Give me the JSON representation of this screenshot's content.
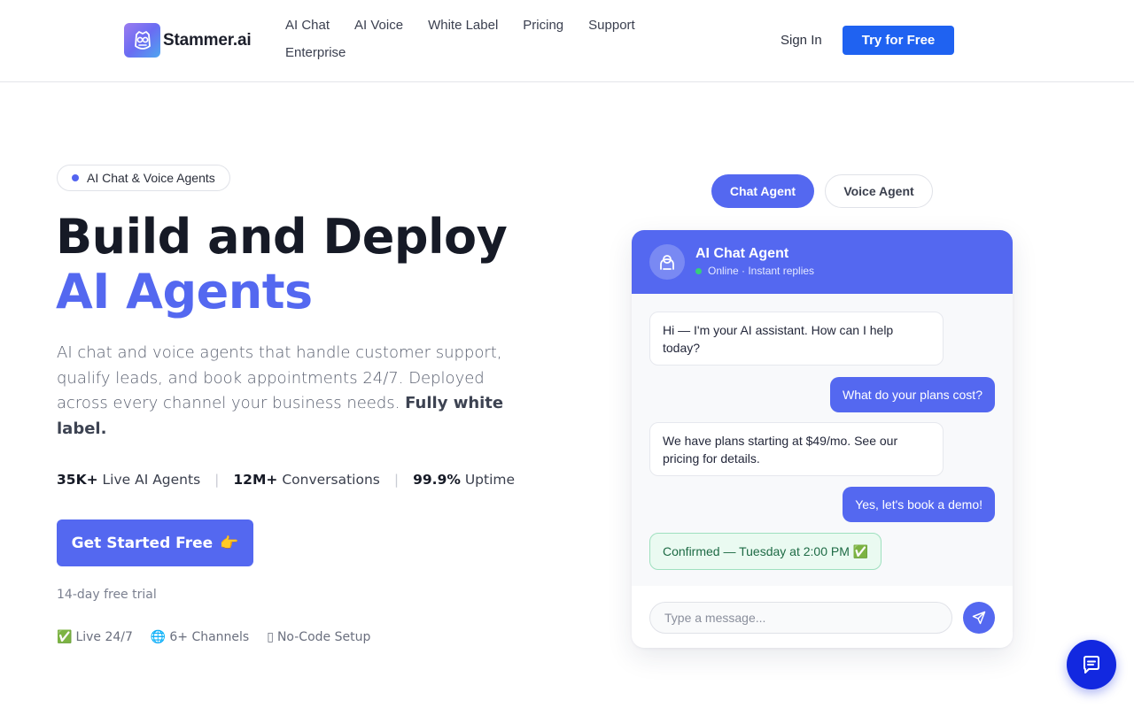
{
  "brand": {
    "name": "Stammer.ai",
    "logo_icon": "owl-logo-icon"
  },
  "nav": {
    "items": [
      "AI Chat",
      "AI Voice",
      "White Label",
      "Pricing",
      "Support",
      "Enterprise"
    ],
    "signin": "Sign In",
    "cta": "Try for Free"
  },
  "hero": {
    "badge": "AI Chat & Voice Agents",
    "title_line1": "Build and Deploy",
    "title_line2": "AI Agents",
    "lead": "AI chat and voice agents that handle customer support, qualify leads, and book appointments 24/7. Deployed across every channel your business needs.",
    "lead_bold": "Fully white label.",
    "stats": [
      {
        "value": "35K+",
        "label": "Live AI Agents"
      },
      {
        "value": "12M+",
        "label": "Conversations"
      },
      {
        "value": "99.9%",
        "label": "Uptime"
      }
    ],
    "cta": "Get Started Free",
    "cta_emoji": "👉",
    "trial": "14-day free trial",
    "features": [
      {
        "icon": "✅",
        "label": "Live 24/7"
      },
      {
        "icon": "🌐",
        "label": "6+ Channels"
      },
      {
        "icon": "▯",
        "label": "No-Code Setup"
      }
    ]
  },
  "toggle": {
    "chat": "Chat Agent",
    "voice": "Voice Agent",
    "active": "chat"
  },
  "chat": {
    "agent_name": "AI Chat Agent",
    "status": "Online · Instant replies",
    "messages": [
      {
        "from": "bot",
        "text": "Hi — I'm your AI assistant. How can I help today?"
      },
      {
        "from": "user",
        "text": "What do your plans cost?"
      },
      {
        "from": "bot",
        "text": "We have plans starting at $49/mo. See our pricing for details."
      },
      {
        "from": "user",
        "text": "Yes, let's book a demo!"
      },
      {
        "from": "system",
        "text": "Confirmed — Tuesday at 2:00 PM ✅"
      }
    ],
    "input_placeholder": "Type a message..."
  },
  "colors": {
    "accent": "#5468f0",
    "nav_cta": "#1f62f1",
    "fab": "#1228e0",
    "online": "#35d07a"
  }
}
